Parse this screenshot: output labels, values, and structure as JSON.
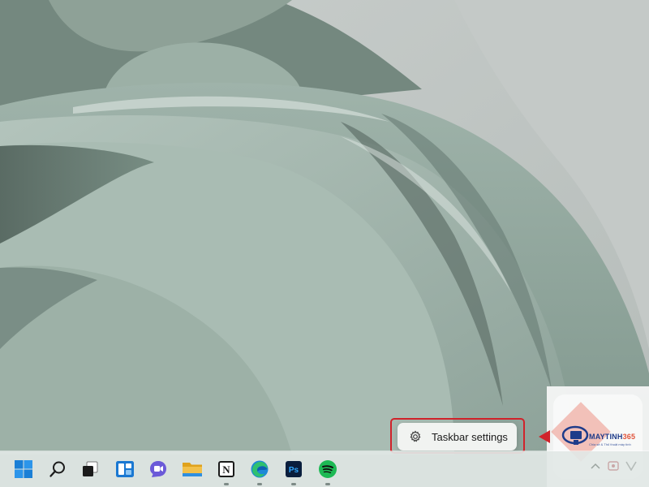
{
  "context_menu": {
    "items": [
      {
        "label": "Taskbar settings",
        "icon": "gear-icon"
      }
    ],
    "highlight_color": "#d0232b"
  },
  "taskbar": {
    "pinned": [
      {
        "name": "start-button",
        "icon": "windows-logo-icon",
        "running": false
      },
      {
        "name": "search-button",
        "icon": "search-icon",
        "running": false
      },
      {
        "name": "task-view-button",
        "icon": "task-view-icon",
        "running": false
      },
      {
        "name": "widgets-button",
        "icon": "widgets-icon",
        "running": false
      },
      {
        "name": "chat-button",
        "icon": "teams-chat-icon",
        "running": false
      },
      {
        "name": "file-explorer-button",
        "icon": "folder-icon",
        "running": false
      },
      {
        "name": "notion-button",
        "icon": "notion-icon",
        "running": true
      },
      {
        "name": "edge-button",
        "icon": "edge-icon",
        "running": true
      },
      {
        "name": "photoshop-button",
        "icon": "photoshop-icon",
        "running": true
      },
      {
        "name": "spotify-button",
        "icon": "spotify-icon",
        "running": true
      }
    ],
    "notion_glyph": "N",
    "photoshop_glyph": "Ps"
  },
  "watermark": {
    "brand_main": "MAYTINH",
    "brand_accent": "365",
    "tagline": "Chia sẻ & Thủ thuật máy tính"
  },
  "colors": {
    "accent_windows": "#1a7fd6",
    "folder": "#f2b632",
    "spotify": "#1db954",
    "photoshop_bg": "#0a1e3d",
    "photoshop_fg": "#31a8ff",
    "highlight": "#d0232b"
  }
}
